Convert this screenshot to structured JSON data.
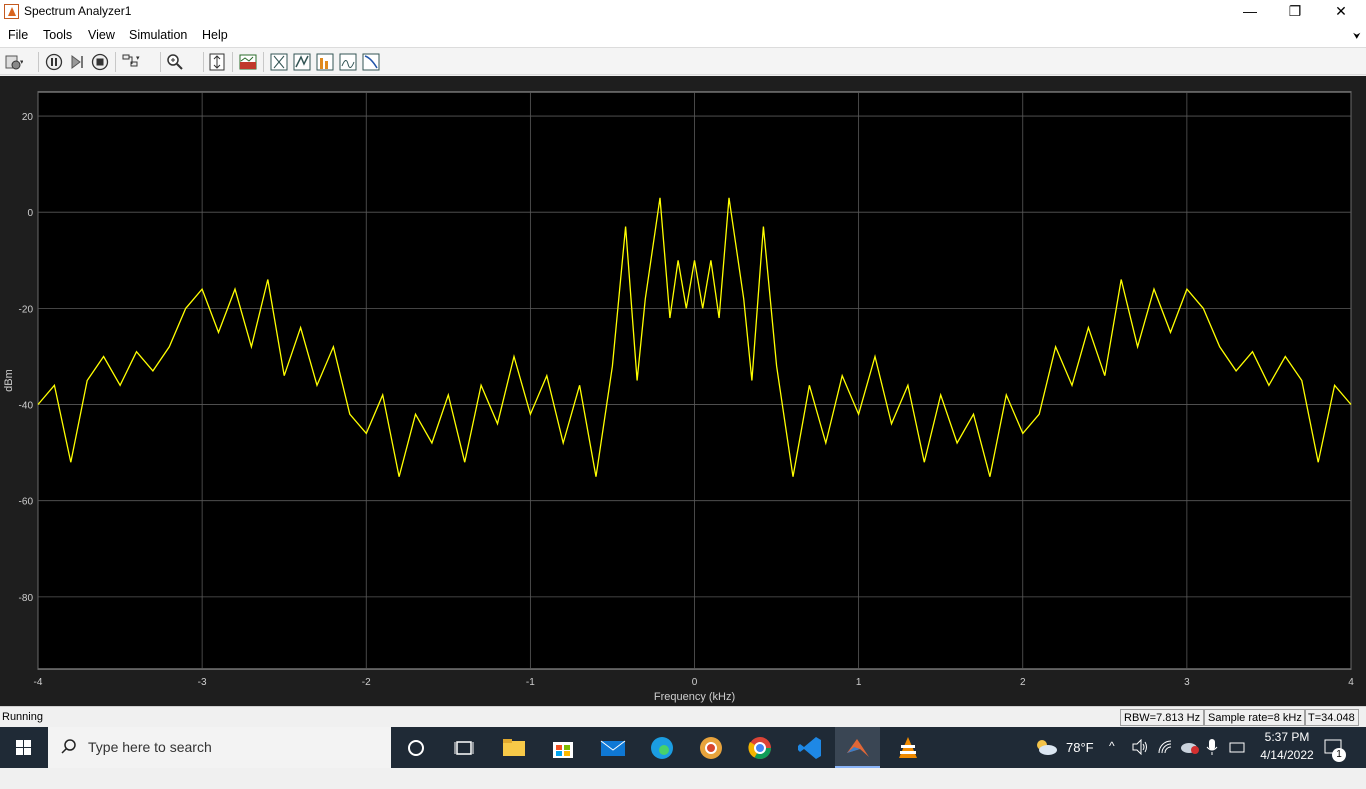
{
  "window": {
    "title": "Spectrum Analyzer1",
    "minimize": "—",
    "restore": "❐",
    "close": "✕"
  },
  "menu": {
    "items": [
      "File",
      "Tools",
      "View",
      "Simulation",
      "Help"
    ],
    "collapse_glyph": "⮟"
  },
  "toolbar": {
    "icons": [
      "settings-icon",
      "pause-icon",
      "step-forward-icon",
      "stop-icon",
      "signal-select-icon",
      "zoom-icon",
      "scale-axes-icon",
      "spectrum-settings-icon",
      "cursor-measurements-icon",
      "peak-finder-icon",
      "distortion-measurements-icon",
      "ccdf-measurements-icon",
      "channel-measurements-icon"
    ]
  },
  "chart_data": {
    "type": "line",
    "title": "",
    "xlabel": "Frequency (kHz)",
    "ylabel": "dBm",
    "xlim": [
      -4,
      4
    ],
    "ylim": [
      -95,
      25
    ],
    "xticks": [
      -4,
      -3,
      -2,
      -1,
      0,
      1,
      2,
      3,
      4
    ],
    "yticks": [
      20,
      0,
      -20,
      -40,
      -60,
      -80
    ],
    "grid": true,
    "background": "#000000",
    "line_color": "#ffff00",
    "series": [
      {
        "x": [
          -4,
          -3.9,
          -3.8,
          -3.7,
          -3.6,
          -3.5,
          -3.4,
          -3.3,
          -3.2,
          -3.1,
          -3.0,
          -2.9,
          -2.8,
          -2.7,
          -2.6,
          -2.5,
          -2.4,
          -2.3,
          -2.2,
          -2.1,
          -2.0,
          -1.9,
          -1.8,
          -1.7,
          -1.6,
          -1.5,
          -1.4,
          -1.3,
          -1.2,
          -1.1,
          -1.0,
          -0.9,
          -0.8,
          -0.7,
          -0.6,
          -0.5,
          -0.42,
          -0.35,
          -0.3,
          -0.21,
          -0.15,
          -0.1,
          -0.05,
          0.0,
          0.05,
          0.1,
          0.15,
          0.21,
          0.3,
          0.35,
          0.42,
          0.5,
          0.6,
          0.7,
          0.8,
          0.9,
          1.0,
          1.1,
          1.2,
          1.3,
          1.4,
          1.5,
          1.6,
          1.7,
          1.8,
          1.9,
          2.0,
          2.1,
          2.2,
          2.3,
          2.4,
          2.5,
          2.6,
          2.7,
          2.8,
          2.9,
          3.0,
          3.1,
          3.2,
          3.3,
          3.4,
          3.5,
          3.6,
          3.7,
          3.8,
          3.9,
          4.0
        ],
        "y": [
          -40,
          -36,
          -52,
          -35,
          -30,
          -36,
          -29,
          -33,
          -28,
          -20,
          -16,
          -25,
          -16,
          -28,
          -14,
          -34,
          -24,
          -36,
          -28,
          -42,
          -46,
          -38,
          -55,
          -42,
          -48,
          -38,
          -52,
          -36,
          -44,
          -30,
          -42,
          -34,
          -48,
          -36,
          -55,
          -32,
          -3,
          -35,
          -18,
          3,
          -22,
          -10,
          -20,
          -10,
          -20,
          -10,
          -22,
          3,
          -18,
          -35,
          -3,
          -32,
          -55,
          -36,
          -48,
          -34,
          -42,
          -30,
          -44,
          -36,
          -52,
          -38,
          -48,
          -42,
          -55,
          -38,
          -46,
          -42,
          -28,
          -36,
          -24,
          -34,
          -14,
          -28,
          -16,
          -25,
          -16,
          -20,
          -28,
          -33,
          -29,
          -36,
          -30,
          -35,
          -52,
          -36,
          -40
        ]
      }
    ]
  },
  "status": {
    "state": "Running",
    "rbw": "RBW=7.813 Hz",
    "sample_rate": "Sample rate=8 kHz",
    "time": "T=34.048"
  },
  "taskbar": {
    "search_placeholder": "Type here to search",
    "apps": [
      "cortana-icon",
      "task-view-icon",
      "file-explorer-icon",
      "store-icon",
      "mail-icon",
      "edge-icon",
      "chrome-canary-icon",
      "chrome-icon",
      "vscode-icon",
      "matlab-icon",
      "vlc-icon"
    ],
    "weather": "78°F",
    "time": "5:37 PM",
    "date": "4/14/2022",
    "notification_count": "1"
  }
}
